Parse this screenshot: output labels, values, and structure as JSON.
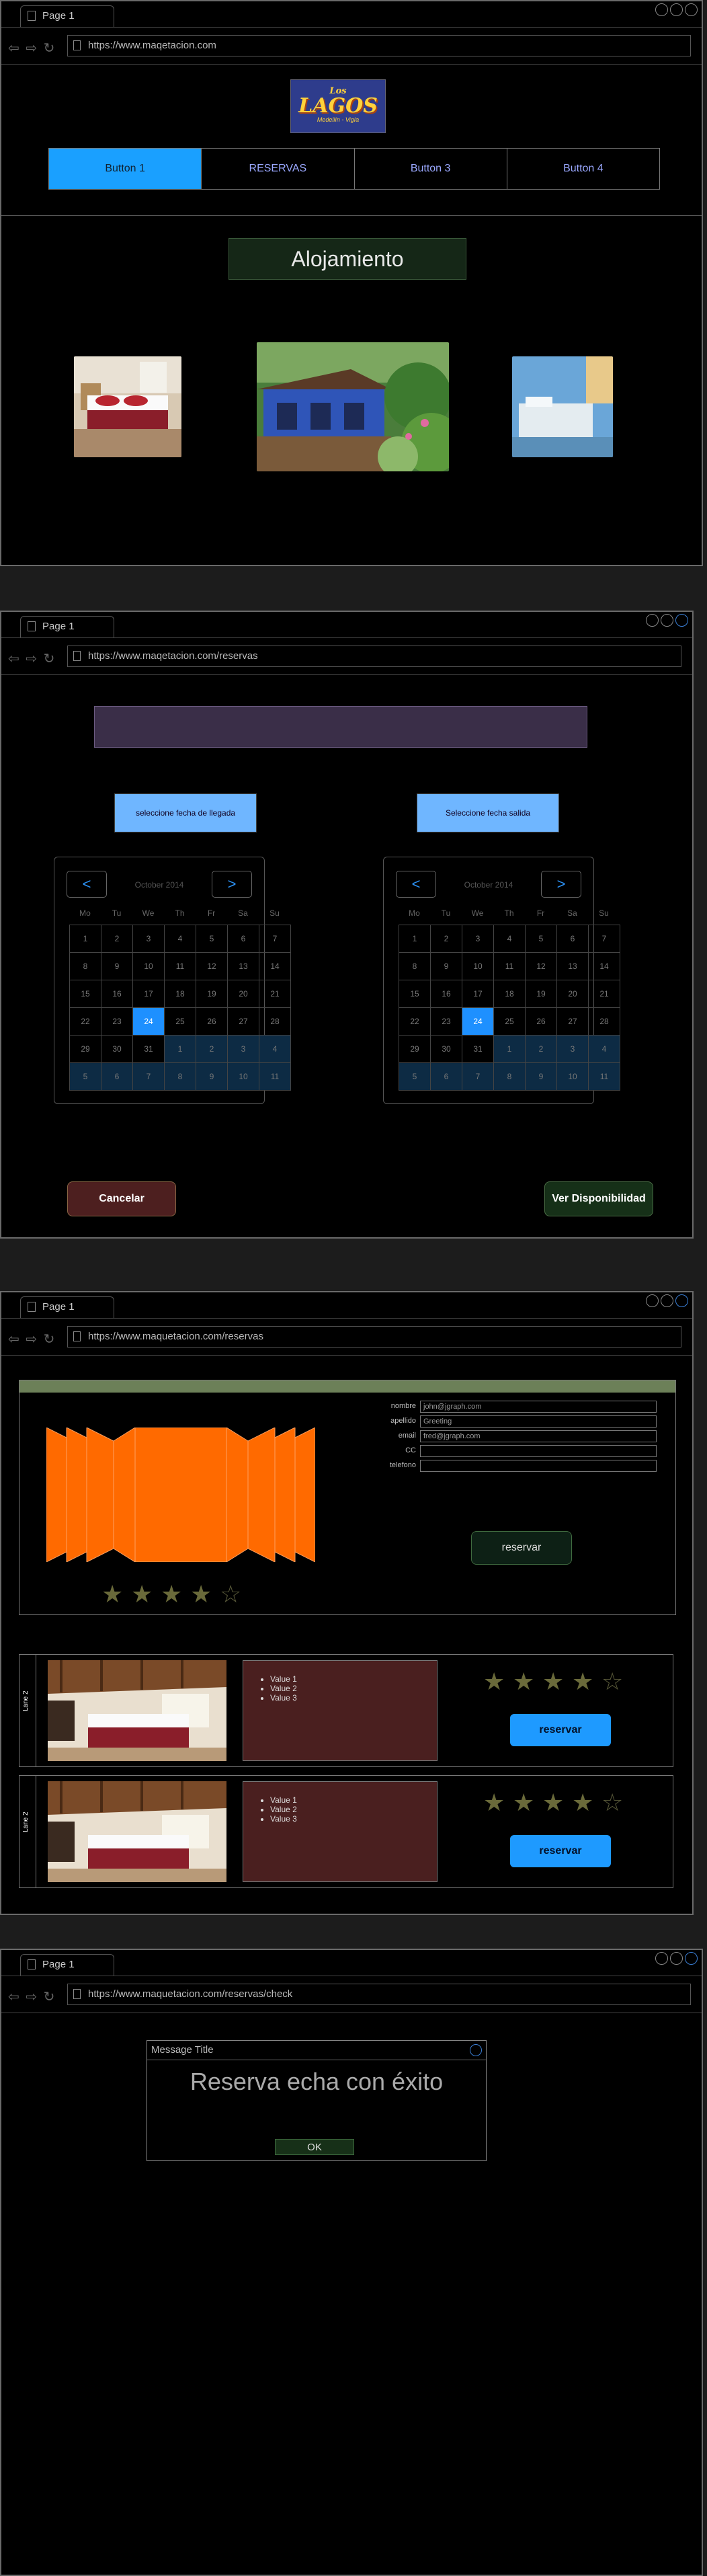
{
  "browser": {
    "tab_label": "Page 1",
    "nav_icons": "⇦ ⇨ ↻"
  },
  "frame1": {
    "url": "https://www.maqetacion.com",
    "logo": {
      "line1": "Los",
      "line2": "LAGOS",
      "line3": "Medellín - Vigía"
    },
    "nav_buttons": [
      "Button 1",
      "RESERVAS",
      "Button 3",
      "Button 4"
    ],
    "active_button": "Button 1",
    "section_title": "Alojamiento"
  },
  "frame2": {
    "url": "https://www.maqetacion.com/reservas",
    "arrival_button": "seleccione fecha de llegada",
    "departure_button": "Seleccione fecha salida",
    "calendar": {
      "month": "October 2014",
      "prev": "<",
      "next": ">",
      "day_names": [
        "Mo",
        "Tu",
        "We",
        "Th",
        "Fr",
        "Sa",
        "Su"
      ],
      "days": [
        "1",
        "2",
        "3",
        "4",
        "5",
        "6",
        "7",
        "8",
        "9",
        "10",
        "11",
        "12",
        "13",
        "14",
        "15",
        "16",
        "17",
        "18",
        "19",
        "20",
        "21",
        "22",
        "23",
        "24",
        "25",
        "26",
        "27",
        "28",
        "29",
        "30",
        "31",
        "1",
        "2",
        "3",
        "4",
        "5",
        "6",
        "7",
        "8",
        "9",
        "10",
        "11"
      ],
      "selected": "24"
    },
    "cancel_label": "Cancelar",
    "availability_label": "Ver Disponibilidad"
  },
  "frame3": {
    "url": "https://www.maquetacion.com/reservas",
    "form": {
      "fields": [
        {
          "label": "nombre",
          "value": "john@jgraph.com"
        },
        {
          "label": "apellido",
          "value": "Greeting"
        },
        {
          "label": "email",
          "value": "fred@jgraph.com"
        },
        {
          "label": "CC",
          "value": ""
        },
        {
          "label": "telefono",
          "value": ""
        }
      ],
      "submit_label": "reservar",
      "rating": {
        "filled": 4,
        "total": 5
      }
    },
    "rooms": [
      {
        "side_label": "Lane 2",
        "values": [
          "Value 1",
          "Value 2",
          "Value 3"
        ],
        "button": "reservar",
        "rating": {
          "filled": 4,
          "total": 5
        }
      },
      {
        "side_label": "Lane 2",
        "values": [
          "Value 1",
          "Value 2",
          "Value 3"
        ],
        "button": "reservar",
        "rating": {
          "filled": 4,
          "total": 5
        }
      }
    ]
  },
  "frame4": {
    "url": "https://www.maquetacion.com/reservas/check",
    "dialog": {
      "title": "Message Title",
      "message": "Reserva echa con éxito",
      "ok_label": "OK"
    }
  },
  "colors": {
    "accent_blue": "#1aa0ff",
    "calendar_selected": "#1e90ff",
    "form_header": "#6c8058",
    "cancel_bg": "#4d1f1f",
    "confirm_bg": "#163018",
    "carousel_orange": "#ff6a00"
  }
}
